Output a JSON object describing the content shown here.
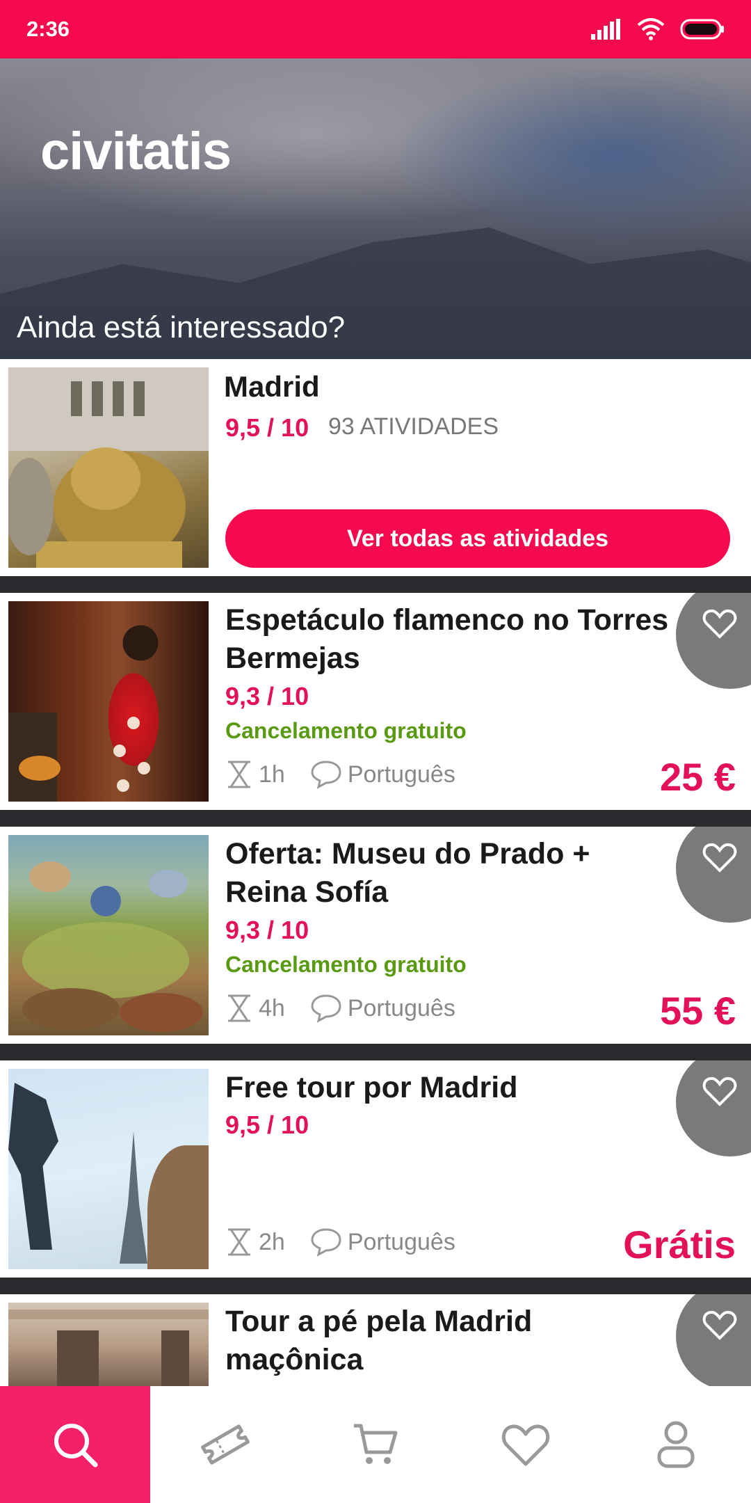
{
  "status_bar": {
    "time": "2:36"
  },
  "hero": {
    "logo": "civitatis",
    "subtitle": "Ainda está interessado?"
  },
  "destination": {
    "name": "Madrid",
    "rating": "9,5 / 10",
    "activities": "93 ATIVIDADES",
    "button_label": "Ver todas as atividades"
  },
  "activities": [
    {
      "title": "Espetáculo flamenco no Torres Bermejas",
      "rating": "9,3 / 10",
      "cancellation": "Cancelamento gratuito",
      "duration": "1h",
      "language": "Português",
      "price": "25 €"
    },
    {
      "title": "Oferta: Museu do Prado + Reina Sofía",
      "rating": "9,3 / 10",
      "cancellation": "Cancelamento gratuito",
      "duration": "4h",
      "language": "Português",
      "price": "55 €"
    },
    {
      "title": "Free tour por Madrid",
      "rating": "9,5 / 10",
      "duration": "2h",
      "language": "Português",
      "price": "Grátis"
    },
    {
      "title": "Tour a pé pela Madrid maçônica"
    }
  ],
  "nav": {
    "items": [
      "search-icon",
      "ticket-icon",
      "cart-icon",
      "heart-icon",
      "user-icon"
    ],
    "active": "search"
  },
  "colors": {
    "brand": "#f50a4e",
    "green": "#5a9a12",
    "price": "#e2115a"
  }
}
